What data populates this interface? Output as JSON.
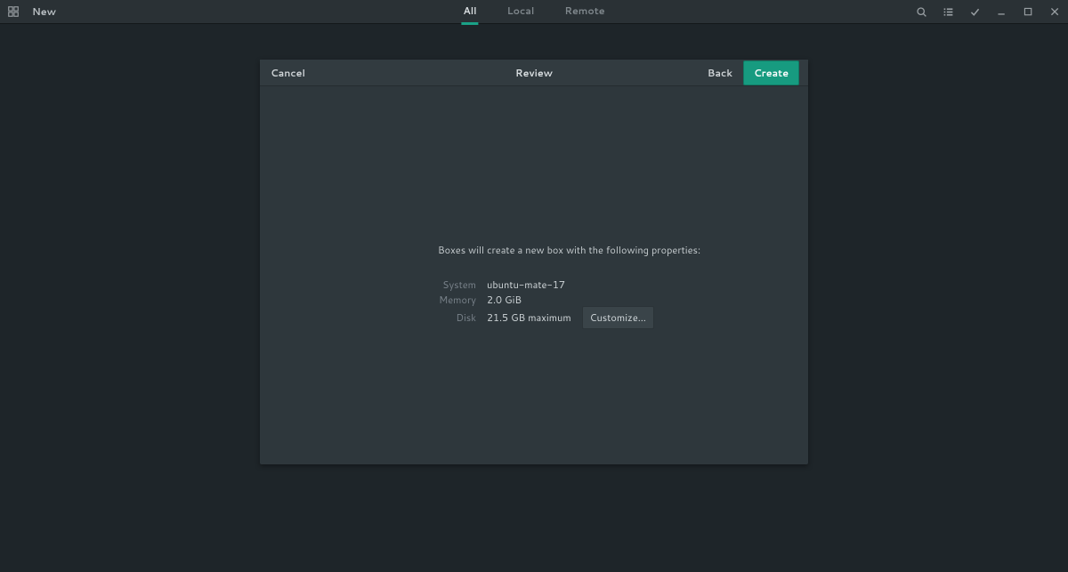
{
  "titlebar": {
    "new_label": "New",
    "tabs": {
      "all": "All",
      "local": "Local",
      "remote": "Remote"
    }
  },
  "dialog": {
    "cancel_label": "Cancel",
    "title": "Review",
    "back_label": "Back",
    "create_label": "Create",
    "intro": "Boxes will create a new box with the following properties:",
    "rows": {
      "system": {
        "label": "System",
        "value": "ubuntu-mate-17"
      },
      "memory": {
        "label": "Memory",
        "value": "2.0 GiB"
      },
      "disk": {
        "label": "Disk",
        "value": "21.5 GB maximum"
      }
    },
    "customize_label": "Customize…"
  }
}
